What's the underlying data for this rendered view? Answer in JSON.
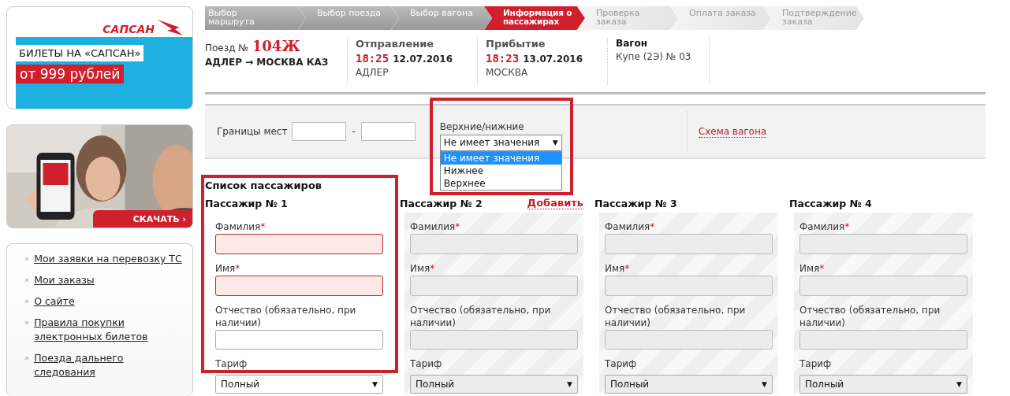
{
  "sidebar": {
    "sapsan_banner": {
      "logo": "САПСАН",
      "headline": "БИЛЕТЫ НА «САПСАН»",
      "price": "от 999 рублей"
    },
    "app_banner": {
      "kind": "picture",
      "button": "СКАЧАТЬ ›"
    },
    "links": [
      {
        "bullet": "»",
        "label": "Мои заявки на перевозку ТС"
      },
      {
        "bullet": "»",
        "label": "Мои заказы"
      },
      {
        "bullet": "»",
        "label": "О сайте"
      },
      {
        "bullet": "»",
        "label": "Правила покупки электронных билетов"
      },
      {
        "bullet": "»",
        "label": "Поезда дальнего следования"
      }
    ]
  },
  "steps": [
    {
      "label": "Выбор маршрута",
      "done": true,
      "selected": false
    },
    {
      "label": "Выбор поезда",
      "done": true,
      "selected": false
    },
    {
      "label": "Выбор вагона",
      "done": true,
      "selected": false
    },
    {
      "label": "Информация о пассажирах",
      "done": false,
      "selected": true
    },
    {
      "label": "Проверка заказа",
      "done": false,
      "selected": false
    },
    {
      "label": "Оплата заказа",
      "done": false,
      "selected": false
    },
    {
      "label": "Подтверждение заказа",
      "done": false,
      "selected": false
    }
  ],
  "train": {
    "label": "Поезд №",
    "number": "104Ж",
    "route": "АДЛЕР → МОСКВА КАЗ"
  },
  "departure": {
    "title": "Отправление",
    "time": "18:25",
    "date": "12.07.2016",
    "station": "АДЛЕР"
  },
  "arrival": {
    "title": "Прибытие",
    "time": "18:23",
    "date": "13.07.2016",
    "station": "МОСКВА"
  },
  "car": {
    "title": "Вагон",
    "value": "Купе (2Э) № 03"
  },
  "filter": {
    "seats_label": "Границы мест",
    "dash": "-",
    "berth_label": "Верхние/нижние",
    "berth_value": "Не имеет значения",
    "berth_caret": "▼",
    "berth_open": true,
    "berth_highlighted": true,
    "berth_options": [
      {
        "label": "Не имеет значения",
        "selected": true
      },
      {
        "label": "Нижнее",
        "selected": false
      },
      {
        "label": "Верхнее",
        "selected": false
      }
    ],
    "scheme_link": "Схема вагона"
  },
  "passengers_title": "Список пассажиров",
  "passengers": [
    {
      "title": "Пассажир № 1",
      "highlighted": true,
      "disabled": false,
      "surname": {
        "label": "Фамилия",
        "required_mark": "*",
        "error": true
      },
      "name": {
        "label": "Имя",
        "required_mark": "*",
        "error": true
      },
      "patronymic": {
        "label": "Отчество (обязательно, при наличии)",
        "error": false
      },
      "tariff_label": "Тариф",
      "tariff": "Полный",
      "tariff_caret": "▼"
    },
    {
      "title": "Пассажир № 2",
      "add_link": "Добавить",
      "disabled": true,
      "surname": {
        "label": "Фамилия",
        "required_mark": "*",
        "error": false
      },
      "name": {
        "label": "Имя",
        "required_mark": "*",
        "error": false
      },
      "patronymic": {
        "label": "Отчество (обязательно, при наличии)",
        "error": false
      },
      "tariff_label": "Тариф",
      "tariff": "Полный",
      "tariff_caret": "▼"
    },
    {
      "title": "Пассажир № 3",
      "disabled": true,
      "surname": {
        "label": "Фамилия",
        "required_mark": "*",
        "error": false
      },
      "name": {
        "label": "Имя",
        "required_mark": "*",
        "error": false
      },
      "patronymic": {
        "label": "Отчество (обязательно, при наличии)",
        "error": false
      },
      "tariff_label": "Тариф",
      "tariff": "Полный",
      "tariff_caret": "▼"
    },
    {
      "title": "Пассажир № 4",
      "disabled": true,
      "surname": {
        "label": "Фамилия",
        "required_mark": "*",
        "error": false
      },
      "name": {
        "label": "Имя",
        "required_mark": "*",
        "error": false
      },
      "patronymic": {
        "label": "Отчество (обязательно, при наличии)",
        "error": false
      },
      "tariff_label": "Тариф",
      "tariff": "Полный",
      "tariff_caret": "▼"
    }
  ]
}
